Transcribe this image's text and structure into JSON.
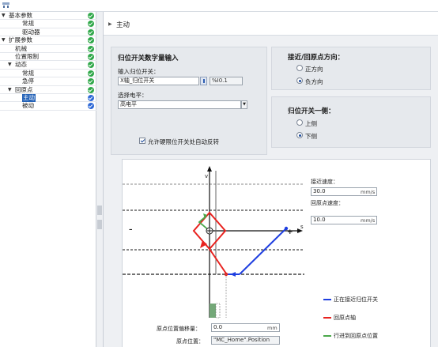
{
  "tree": {
    "items": [
      {
        "label": "基本参数",
        "level": 0,
        "expanded": true,
        "status": "ok"
      },
      {
        "label": "常规",
        "level": 2,
        "status": "ok"
      },
      {
        "label": "驱动器",
        "level": 2,
        "status": "ok"
      },
      {
        "label": "扩展参数",
        "level": 0,
        "expanded": true,
        "status": "ok"
      },
      {
        "label": "机械",
        "level": 1,
        "status": "ok"
      },
      {
        "label": "位置限制",
        "level": 1,
        "status": "ok"
      },
      {
        "label": "动态",
        "level": 1,
        "expanded": true,
        "status": "ok"
      },
      {
        "label": "常规",
        "level": 2,
        "status": "ok"
      },
      {
        "label": "急停",
        "level": 2,
        "status": "ok"
      },
      {
        "label": "回原点",
        "level": 1,
        "expanded": true,
        "status": "ok"
      },
      {
        "label": "主动",
        "level": 2,
        "selected": true,
        "status": "active"
      },
      {
        "label": "被动",
        "level": 2,
        "status": "active"
      }
    ]
  },
  "section": {
    "title": "主动"
  },
  "input_panel": {
    "title": "归位开关数字量输入",
    "input_label": "输入归位开关：",
    "input_value": "X轴_归位开关",
    "address_value": "%I0.1",
    "level_label": "选择电平：",
    "level_value": "高电平",
    "checkbox_label": "允许硬限位开关处自动反转",
    "checkbox_checked": true
  },
  "direction_panel": {
    "title": "接近/回原点方向：",
    "options": [
      {
        "label": "正方向",
        "selected": false
      },
      {
        "label": "负方向",
        "selected": true
      }
    ]
  },
  "side_panel": {
    "title": "归位开关一侧：",
    "options": [
      {
        "label": "上侧",
        "selected": false
      },
      {
        "label": "下侧",
        "selected": true
      }
    ]
  },
  "diagram": {
    "v_axis": "v",
    "s_axis": "s",
    "minus": "–",
    "plus": "+",
    "approach_speed_label": "接近速度：",
    "approach_speed_value": "30.0",
    "approach_speed_unit": "mm/s",
    "homing_speed_label": "回原点速度：",
    "homing_speed_value": "10.0",
    "homing_speed_unit": "mm/s",
    "legend": [
      {
        "label": "正在接近归位开关",
        "color": "#1f3fe0"
      },
      {
        "label": "回原点轴",
        "color": "#e8221f"
      },
      {
        "label": "行进到回原点位置",
        "color": "#4aa84a"
      }
    ]
  },
  "bottom": {
    "offset_label": "原点位置偏移量：",
    "offset_value": "0.0",
    "offset_unit": "mm",
    "position_label": "原点位置：",
    "position_value": "\"MC_Home\".Position"
  },
  "colors": {
    "accent": "#2563b8",
    "ok": "#30a84a",
    "active": "#2f69d6"
  }
}
